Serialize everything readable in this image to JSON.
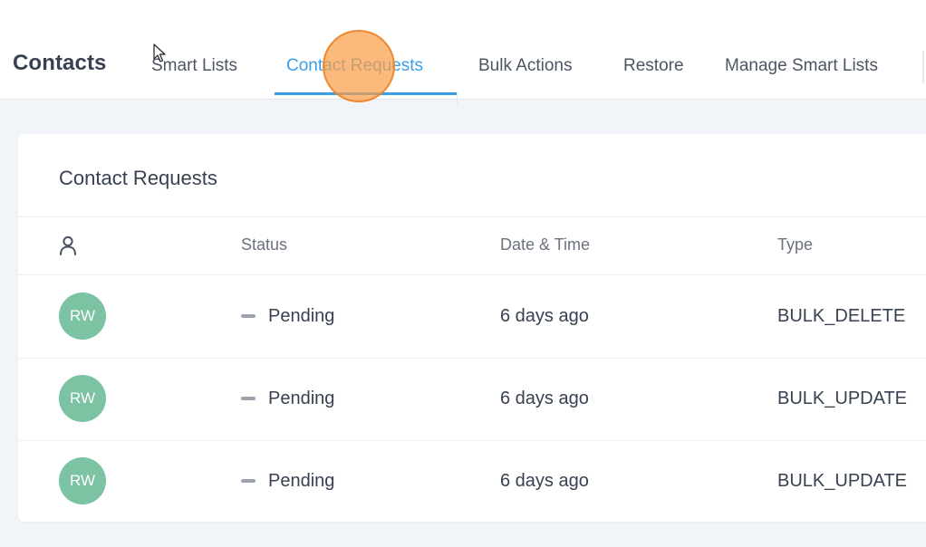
{
  "header": {
    "title": "Contacts",
    "tabs": [
      {
        "label": "Smart Lists"
      },
      {
        "label": "Contact Requests",
        "active": true
      },
      {
        "label": "Bulk Actions"
      },
      {
        "label": "Restore"
      },
      {
        "label": "Manage Smart Lists"
      }
    ]
  },
  "card": {
    "title": "Contact Requests",
    "columns": {
      "contact_icon": "person-icon",
      "status": "Status",
      "datetime": "Date & Time",
      "type": "Type"
    },
    "rows": [
      {
        "initials": "RW",
        "status": "Pending",
        "datetime": "6 days ago",
        "type": "BULK_DELETE"
      },
      {
        "initials": "RW",
        "status": "Pending",
        "datetime": "6 days ago",
        "type": "BULK_UPDATE"
      },
      {
        "initials": "RW",
        "status": "Pending",
        "datetime": "6 days ago",
        "type": "BULK_UPDATE"
      }
    ]
  },
  "colors": {
    "accent": "#3b9ee6",
    "avatar": "#7cc3a3",
    "click_indicator": "#fa9e48",
    "background": "#f1f5f9"
  },
  "icons": {
    "cursor": "arrow-cursor-icon",
    "status_pending": "dash-icon"
  }
}
